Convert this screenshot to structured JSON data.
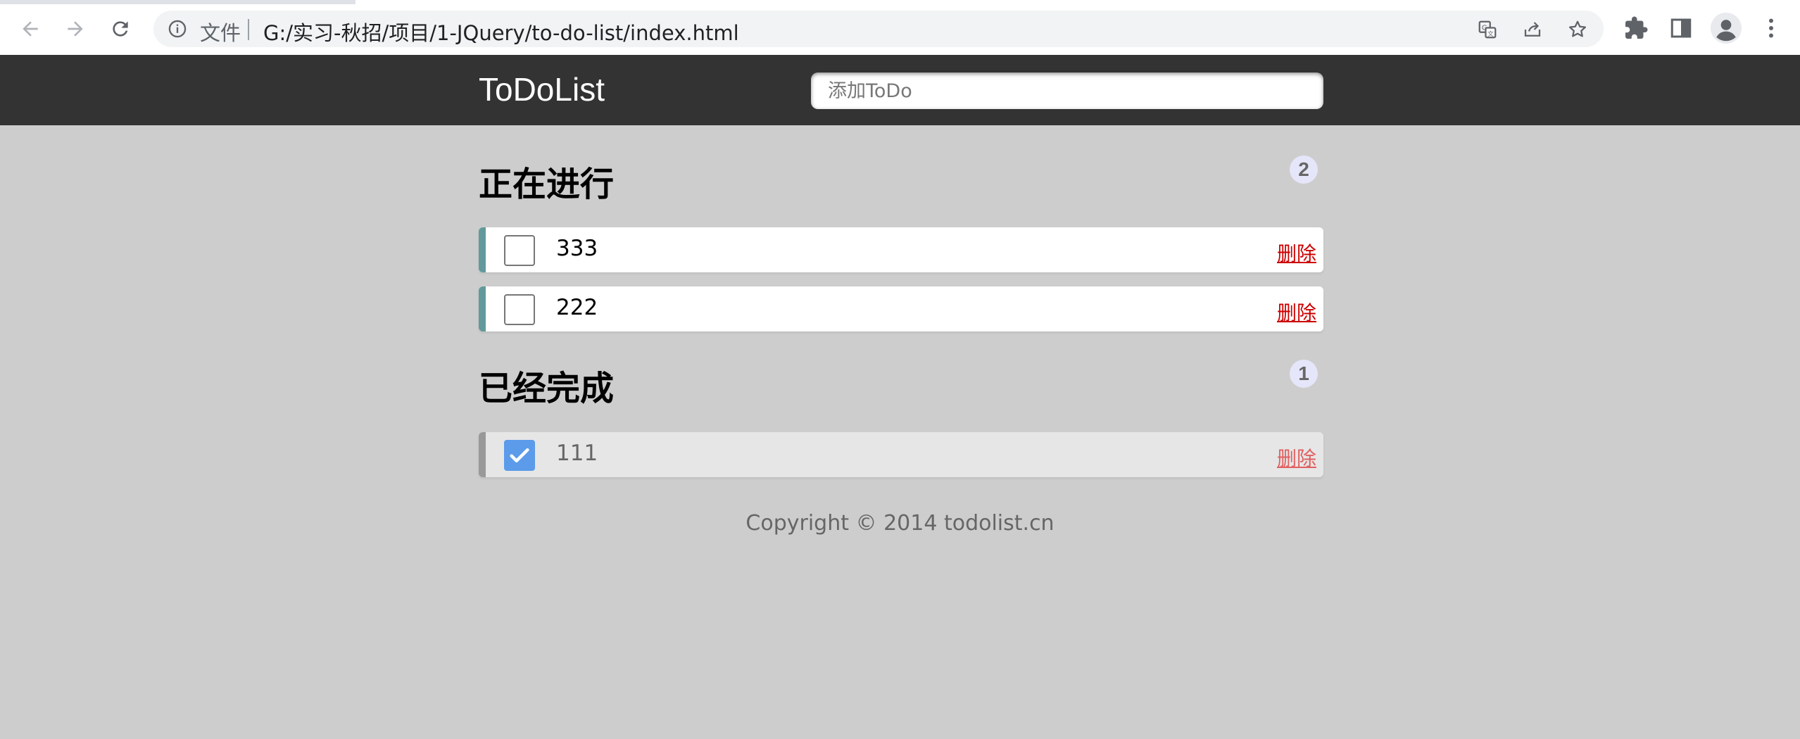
{
  "browser": {
    "scheme_label": "文件",
    "url": "G:/实习-秋招/项目/1-JQuery/to-do-list/index.html",
    "icons": [
      "back-icon",
      "forward-icon",
      "reload-icon",
      "info-icon",
      "translate-icon",
      "share-icon",
      "bookmark-star-icon",
      "extensions-icon",
      "side-panel-icon",
      "profile-icon",
      "menu-icon"
    ]
  },
  "header": {
    "logo": "ToDoList",
    "input_placeholder": "添加ToDo"
  },
  "doing": {
    "title": "正在进行",
    "count": "2",
    "items": [
      {
        "text": "333",
        "done": false,
        "delete_label": "删除"
      },
      {
        "text": "222",
        "done": false,
        "delete_label": "删除"
      }
    ]
  },
  "done": {
    "title": "已经完成",
    "count": "1",
    "items": [
      {
        "text": "111",
        "done": true,
        "delete_label": "删除"
      }
    ]
  },
  "footer": {
    "copyright": "Copyright © 2014 todolist.cn"
  },
  "colors": {
    "page_bg": "#cdcdcd",
    "header_bg": "#333333",
    "todo_accent": "#629a9c",
    "done_accent": "#999999",
    "delete_link": "#cc0000",
    "checkbox_checked": "#5b9bea",
    "count_badge_bg": "#e6e6fa"
  }
}
